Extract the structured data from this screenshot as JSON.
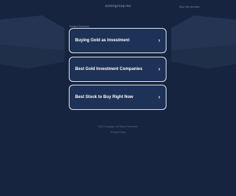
{
  "page": {
    "domain": "ezmingroup.me",
    "buy_link": "Buy this domain"
  },
  "related": {
    "label": "Related Searches",
    "items": [
      {
        "label": "Buying Gold as Investment",
        "chevron": "›"
      },
      {
        "label": "Best Gold Investment Companies",
        "chevron": "›"
      },
      {
        "label": "Best Stock to Buy Right Now",
        "chevron": "›"
      }
    ]
  },
  "footer": {
    "links": "2022 Copyright. All Rights Reserved.",
    "privacy": "Privacy Policy"
  },
  "colors": {
    "background": "#17243f",
    "card": "#1e3157",
    "card_border": "#e7ecf6"
  }
}
